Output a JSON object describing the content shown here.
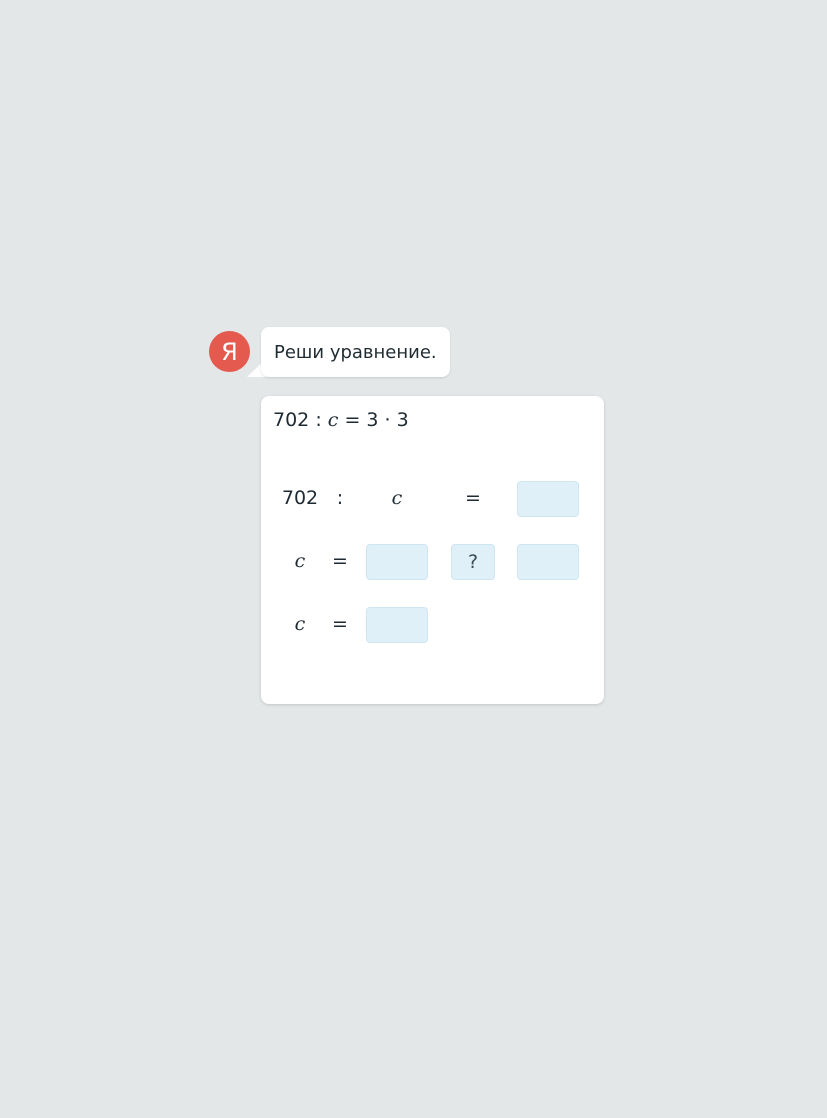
{
  "brand": {
    "avatar_letter": "Я",
    "avatar_color": "#e45a4f",
    "avatar_icon": "yandex-logo-icon"
  },
  "message": {
    "text": "Реши уравнение."
  },
  "task": {
    "equation_num": "702",
    "equation_div": ":",
    "equation_var": "c",
    "equation_rhs": "= 3 · 3",
    "row1": {
      "a": "702",
      "op": ":",
      "var": "c",
      "eq": "="
    },
    "row2": {
      "var": "c",
      "eq": "=",
      "op_placeholder": "?"
    },
    "row3": {
      "var": "c",
      "eq": "="
    }
  },
  "colors": {
    "background": "#e4e7e8",
    "input_fill": "#dff0f9",
    "card": "#ffffff"
  }
}
